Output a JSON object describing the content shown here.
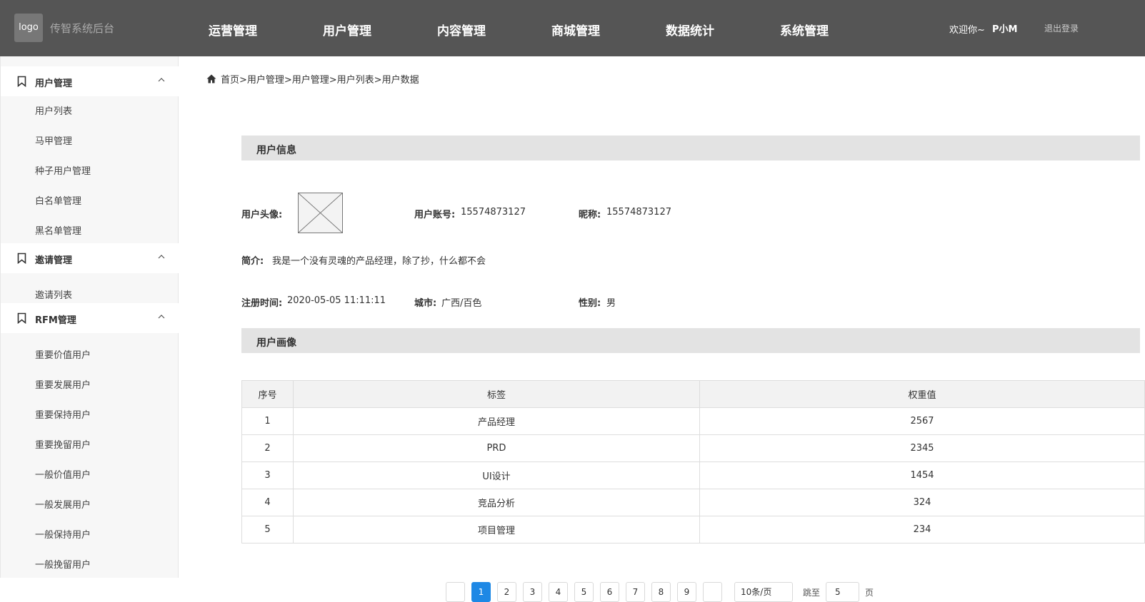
{
  "header": {
    "logo": "logo",
    "system_name": "传智系统后台",
    "nav": [
      "运营管理",
      "用户管理",
      "内容管理",
      "商城管理",
      "数据统计",
      "系统管理"
    ],
    "welcome": "欢迎你~",
    "username": "P小M",
    "logout": "退出登录"
  },
  "sidebar": {
    "groups": [
      {
        "label": "用户管理",
        "items": [
          "用户列表",
          "马甲管理",
          "种子用户管理",
          "白名单管理",
          "黑名单管理"
        ]
      },
      {
        "label": "邀请管理",
        "items": [
          "邀请列表"
        ]
      },
      {
        "label": "RFM管理",
        "items": [
          "重要价值用户",
          "重要发展用户",
          "重要保持用户",
          "重要挽留用户",
          "一般价值用户",
          "一般发展用户",
          "一般保持用户",
          "一般挽留用户"
        ]
      }
    ]
  },
  "breadcrumb": "首页>用户管理>用户管理>用户列表>用户数据",
  "user_info": {
    "section_title": "用户信息",
    "avatar_label": "用户头像:",
    "account_label": "用户账号:",
    "account_value": "15574873127",
    "nickname_label": "昵称:",
    "nickname_value": "15574873127",
    "intro_label": "简介:",
    "intro_value": "我是一个没有灵魂的产品经理，除了抄，什么都不会",
    "register_label": "注册时间:",
    "register_value": "2020-05-05 11:11:11",
    "city_label": "城市:",
    "city_value": "广西/百色",
    "gender_label": "性别:",
    "gender_value": "男"
  },
  "portrait": {
    "section_title": "用户画像",
    "columns": [
      "序号",
      "标签",
      "权重值"
    ],
    "rows": [
      [
        "1",
        "产品经理",
        "2567"
      ],
      [
        "2",
        "PRD",
        "2345"
      ],
      [
        "3",
        "UI设计",
        "1454"
      ],
      [
        "4",
        "竞品分析",
        "324"
      ],
      [
        "5",
        "项目管理",
        "234"
      ]
    ]
  },
  "pagination": {
    "pages": [
      "1",
      "2",
      "3",
      "4",
      "5",
      "6",
      "7",
      "8",
      "9"
    ],
    "active_page": "1",
    "page_size": "10条/页",
    "jump_label": "跳至",
    "jump_value": "5",
    "page_suffix": "页",
    "active_color": "#1e88e5"
  }
}
